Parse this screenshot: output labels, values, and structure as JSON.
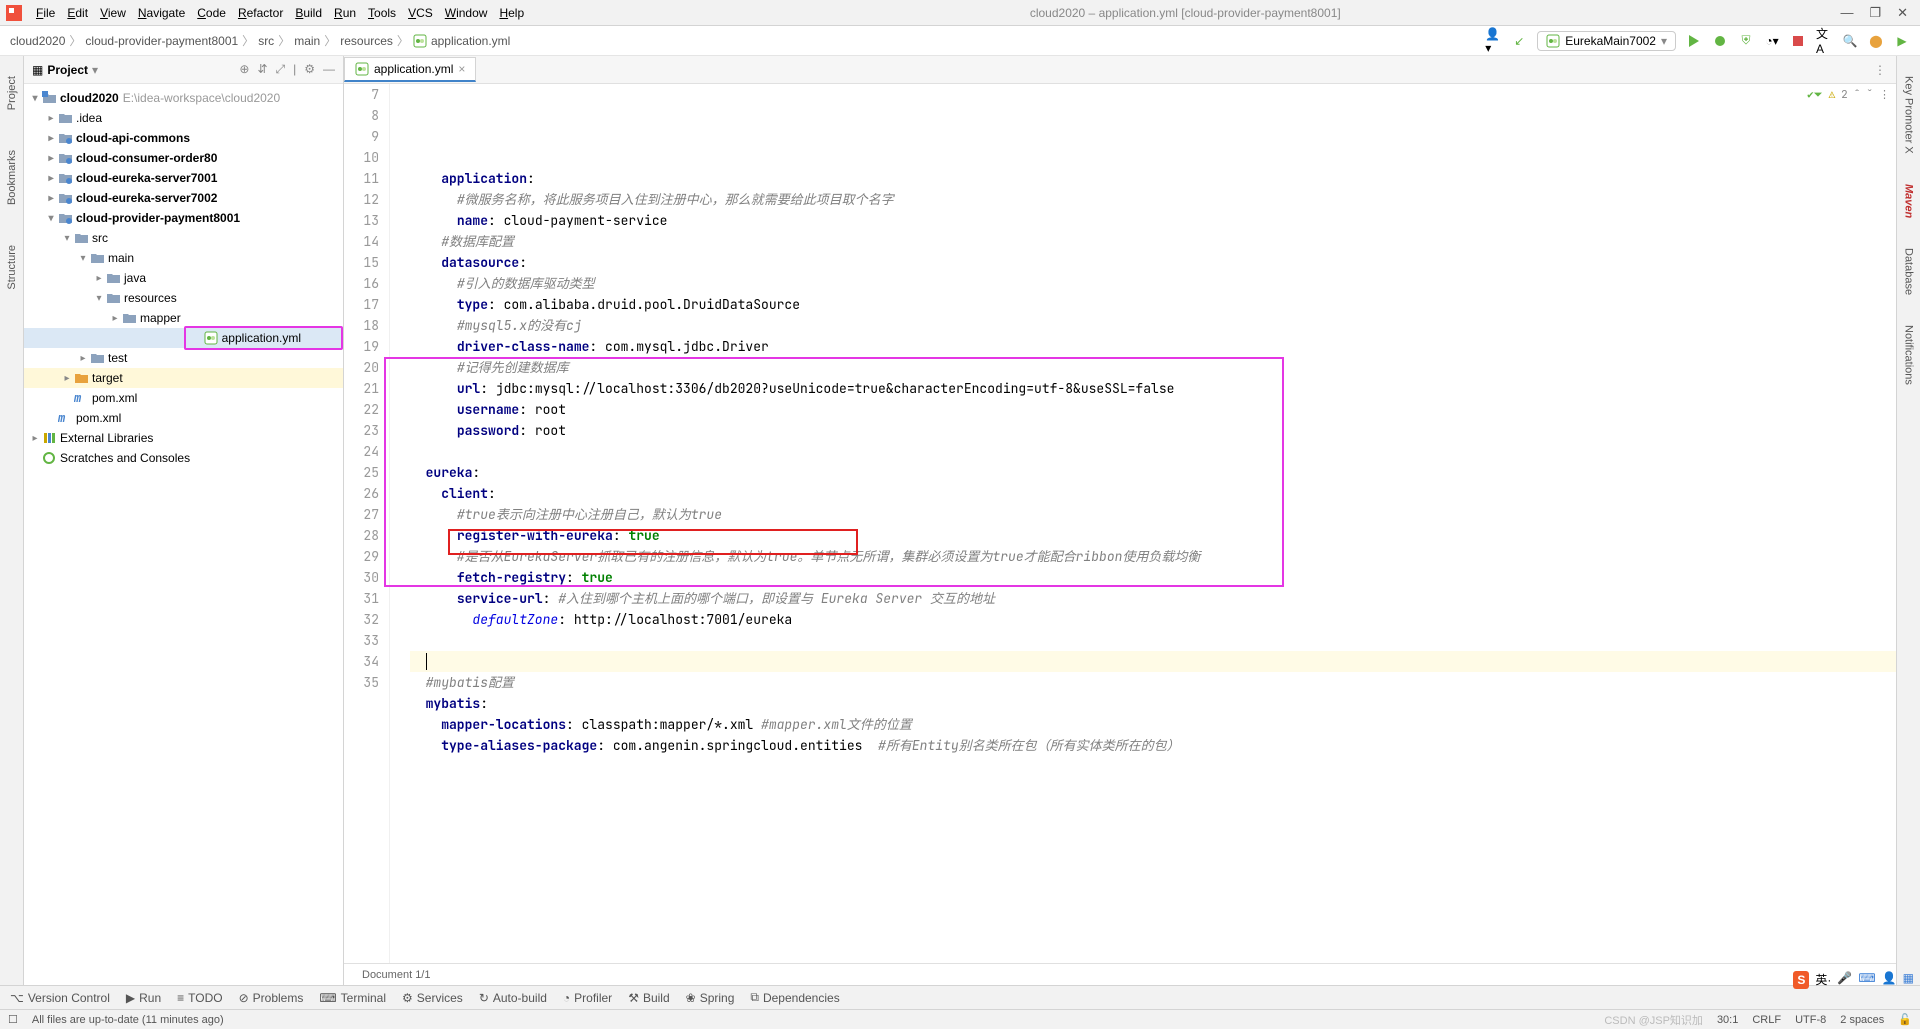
{
  "menu": [
    "File",
    "Edit",
    "View",
    "Navigate",
    "Code",
    "Refactor",
    "Build",
    "Run",
    "Tools",
    "VCS",
    "Window",
    "Help"
  ],
  "menuUnderline": [
    "F",
    "E",
    "V",
    "N",
    "C",
    "R",
    "B",
    "R",
    "T",
    "V",
    "W",
    "H"
  ],
  "windowTitle": "cloud2020 – application.yml [cloud-provider-payment8001]",
  "breadcrumb": [
    "cloud2020",
    "cloud-provider-payment8001",
    "src",
    "main",
    "resources",
    "application.yml"
  ],
  "runConfig": "EurekaMain7002",
  "panel": {
    "title": "Project"
  },
  "tree": [
    {
      "depth": 0,
      "arrow": "▾",
      "bold": true,
      "icon": "project",
      "label": "cloud2020",
      "suffix": "E:\\idea-workspace\\cloud2020"
    },
    {
      "depth": 1,
      "arrow": "▸",
      "icon": "folder",
      "label": ".idea"
    },
    {
      "depth": 1,
      "arrow": "▸",
      "bold": true,
      "icon": "module",
      "label": "cloud-api-commons"
    },
    {
      "depth": 1,
      "arrow": "▸",
      "bold": true,
      "icon": "module",
      "label": "cloud-consumer-order80"
    },
    {
      "depth": 1,
      "arrow": "▸",
      "bold": true,
      "icon": "module",
      "label": "cloud-eureka-server7001"
    },
    {
      "depth": 1,
      "arrow": "▸",
      "bold": true,
      "icon": "module",
      "label": "cloud-eureka-server7002"
    },
    {
      "depth": 1,
      "arrow": "▾",
      "bold": true,
      "icon": "module",
      "label": "cloud-provider-payment8001"
    },
    {
      "depth": 2,
      "arrow": "▾",
      "icon": "folder",
      "label": "src"
    },
    {
      "depth": 3,
      "arrow": "▾",
      "icon": "folder",
      "label": "main"
    },
    {
      "depth": 4,
      "arrow": "▸",
      "icon": "folder",
      "label": "java"
    },
    {
      "depth": 4,
      "arrow": "▾",
      "icon": "folder",
      "label": "resources"
    },
    {
      "depth": 5,
      "arrow": "▸",
      "icon": "folder",
      "label": "mapper"
    },
    {
      "depth": 5,
      "arrow": "",
      "icon": "yml",
      "label": "application.yml",
      "selected": true,
      "highlight": true
    },
    {
      "depth": 3,
      "arrow": "▸",
      "icon": "folder",
      "label": "test",
      "inHighlightEdge": true
    },
    {
      "depth": 2,
      "arrow": "▸",
      "icon": "target",
      "label": "target",
      "target": true
    },
    {
      "depth": 2,
      "arrow": "",
      "icon": "m",
      "label": "pom.xml"
    },
    {
      "depth": 1,
      "arrow": "",
      "icon": "m",
      "label": "pom.xml"
    },
    {
      "depth": 0,
      "arrow": "▸",
      "icon": "lib",
      "label": "External Libraries"
    },
    {
      "depth": 0,
      "arrow": "",
      "icon": "scratch",
      "label": "Scratches and Consoles"
    }
  ],
  "editorTab": "application.yml",
  "lines": [
    7,
    8,
    9,
    10,
    11,
    12,
    13,
    14,
    15,
    16,
    17,
    18,
    19,
    20,
    21,
    22,
    23,
    24,
    25,
    26,
    27,
    28,
    29,
    30,
    31,
    32,
    33,
    34,
    35
  ],
  "code": {
    "l7": {
      "indent": "    ",
      "k": "application",
      "rest": ":"
    },
    "l8": {
      "indent": "      ",
      "c": "#微服务名称，将此服务项目入住到注册中心，那么就需要给此项目取个名字"
    },
    "l9": {
      "indent": "      ",
      "k": "name",
      "rest": ": cloud-payment-service"
    },
    "l10": {
      "indent": "    ",
      "c": "#数据库配置"
    },
    "l11": {
      "indent": "    ",
      "k": "datasource",
      "rest": ":"
    },
    "l12": {
      "indent": "      ",
      "c": "#引入的数据库驱动类型"
    },
    "l13": {
      "indent": "      ",
      "k": "type",
      "rest": ": com.alibaba.druid.pool.DruidDataSource"
    },
    "l14": {
      "indent": "      ",
      "c": "#mysql5.x的没有cj"
    },
    "l15": {
      "indent": "      ",
      "k": "driver-class-name",
      "rest": ": com.mysql.jdbc.Driver"
    },
    "l16": {
      "indent": "      ",
      "c": "#记得先创建数据库"
    },
    "l17": {
      "indent": "      ",
      "k": "url",
      "rest": ": jdbc:mysql://localhost:3306/db2020?useUnicode=true&characterEncoding=utf-8&useSSL=false"
    },
    "l18": {
      "indent": "      ",
      "k": "username",
      "rest": ": root"
    },
    "l19": {
      "indent": "      ",
      "k": "password",
      "rest": ": root"
    },
    "l20": {
      "indent": ""
    },
    "l21": {
      "indent": "  ",
      "k": "eureka",
      "rest": ":"
    },
    "l22": {
      "indent": "    ",
      "k": "client",
      "rest": ":"
    },
    "l23": {
      "indent": "      ",
      "c": "#true表示向注册中心注册自己，默认为true"
    },
    "l24": {
      "indent": "      ",
      "k": "register-with-eureka",
      "rest": ": ",
      "v": "true"
    },
    "l25": {
      "indent": "      ",
      "c": "#是否从EurekaServer抓取已有的注册信息，默认为true。单节点无所谓，集群必须设置为true才能配合ribbon使用负载均衡"
    },
    "l26": {
      "indent": "      ",
      "k": "fetch-registry",
      "rest": ": ",
      "v": "true"
    },
    "l27": {
      "indent": "      ",
      "k": "service-url",
      "rest": ": ",
      "c": "#入住到哪个主机上面的哪个端口，即设置与 Eureka Server 交互的地址"
    },
    "l28": {
      "indent": "        ",
      "ku": "defaultZone",
      "rest": ": http://localhost:7001/eureka"
    },
    "l29": {
      "indent": ""
    },
    "l30": {
      "indent": "  ",
      "cursor": true
    },
    "l31": {
      "indent": "  ",
      "c": "#mybatis配置"
    },
    "l32": {
      "indent": "  ",
      "k": "mybatis",
      "rest": ":"
    },
    "l33": {
      "indent": "    ",
      "k": "mapper-locations",
      "rest": ": classpath:mapper/*.xml ",
      "c": "#mapper.xml文件的位置"
    },
    "l34": {
      "indent": "    ",
      "k": "type-aliases-package",
      "rest": ": com.angenin.springcloud.entities  ",
      "c": "#所有Entity别名类所在包（所有实体类所在的包）"
    },
    "l35": {
      "indent": ""
    }
  },
  "problemsCount": "2",
  "docIndicator": "Document 1/1",
  "bottomTools": [
    "Version Control",
    "Run",
    "TODO",
    "Problems",
    "Terminal",
    "Services",
    "Auto-build",
    "Profiler",
    "Build",
    "Spring",
    "Dependencies"
  ],
  "status": {
    "msg": "All files are up-to-date (11 minutes ago)",
    "pos": "30:1",
    "eol": "CRLF",
    "enc": "UTF-8",
    "indent": "2 spaces",
    "watermark": "CSDN @JSP知识加"
  },
  "sidebarsLeft": [
    "Project",
    "Bookmarks",
    "Structure"
  ],
  "sidebarsRight": [
    "Key Promoter X",
    "Maven",
    "Database",
    "Notifications"
  ]
}
